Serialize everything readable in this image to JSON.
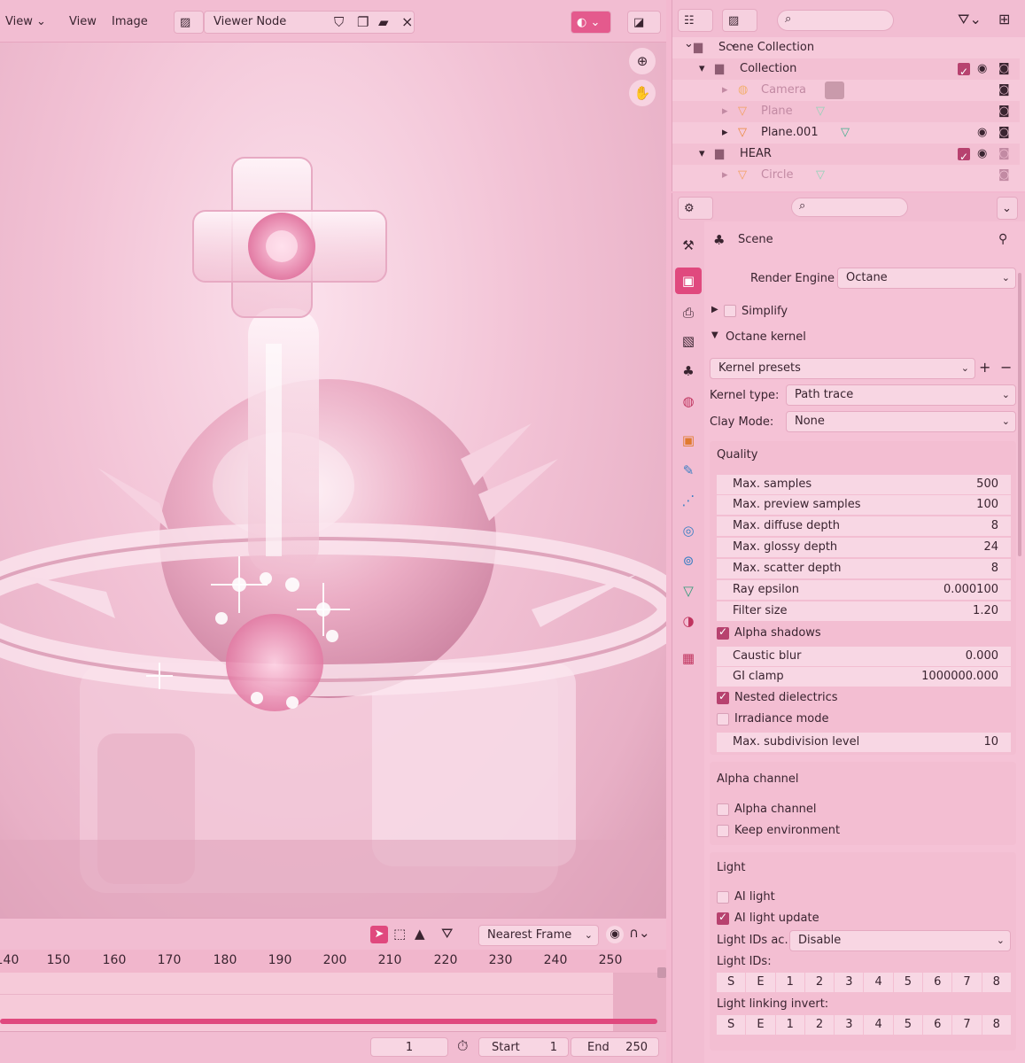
{
  "viewer_header": {
    "view1": "View",
    "view2": "View",
    "image": "Image",
    "viewer_node": "Viewer Node"
  },
  "timeline": {
    "filter_mode": "Nearest Frame",
    "ticks": [
      "140",
      "150",
      "160",
      "170",
      "180",
      "190",
      "200",
      "210",
      "220",
      "230",
      "240",
      "250"
    ],
    "current_frame": "1",
    "start_label": "Start",
    "start_value": "1",
    "end_label": "End",
    "end_value": "250"
  },
  "outliner": {
    "scene_collection": "Scene Collection",
    "rows": [
      {
        "name": "Collection",
        "dim": false
      },
      {
        "name": "Camera",
        "dim": true
      },
      {
        "name": "Plane",
        "dim": true
      },
      {
        "name": "Plane.001",
        "dim": false
      },
      {
        "name": "HEAR",
        "dim": false
      },
      {
        "name": "Circle",
        "dim": true
      }
    ]
  },
  "properties": {
    "context": "Scene",
    "render_engine_label": "Render Engine",
    "render_engine_value": "Octane",
    "simplify": "Simplify",
    "octane_kernel": "Octane kernel",
    "kernel_presets": "Kernel presets",
    "kernel_type_label": "Kernel type:",
    "kernel_type_value": "Path trace",
    "clay_mode_label": "Clay Mode:",
    "clay_mode_value": "None",
    "quality": {
      "title": "Quality",
      "fields": [
        {
          "k": "Max. samples",
          "v": "500"
        },
        {
          "k": "Max. preview samples",
          "v": "100"
        },
        {
          "k": "Max. diffuse depth",
          "v": "8"
        },
        {
          "k": "Max. glossy depth",
          "v": "24"
        },
        {
          "k": "Max. scatter depth",
          "v": "8"
        },
        {
          "k": "Ray epsilon",
          "v": "0.000100"
        },
        {
          "k": "Filter size",
          "v": "1.20"
        }
      ],
      "alpha_shadows": "Alpha shadows",
      "caustic_blur_k": "Caustic blur",
      "caustic_blur_v": "0.000",
      "gi_clamp_k": "GI clamp",
      "gi_clamp_v": "1000000.000",
      "nested_dielectrics": "Nested dielectrics",
      "irradiance_mode": "Irradiance mode",
      "max_subdiv_k": "Max. subdivision level",
      "max_subdiv_v": "10"
    },
    "alpha_channel": {
      "title": "Alpha channel",
      "alpha_channel": "Alpha channel",
      "keep_environment": "Keep environment"
    },
    "light": {
      "title": "Light",
      "ai_light": "AI light",
      "ai_light_update": "AI light update",
      "light_ids_action_label": "Light IDs ac...",
      "light_ids_action_value": "Disable",
      "light_ids_label": "Light IDs:",
      "light_linking_label": "Light linking invert:",
      "ids": [
        "S",
        "E",
        "1",
        "2",
        "3",
        "4",
        "5",
        "6",
        "7",
        "8"
      ]
    }
  },
  "colors": {
    "accent": "#e0497e",
    "panel": "#f3bed2",
    "field": "#f8d7e4"
  }
}
